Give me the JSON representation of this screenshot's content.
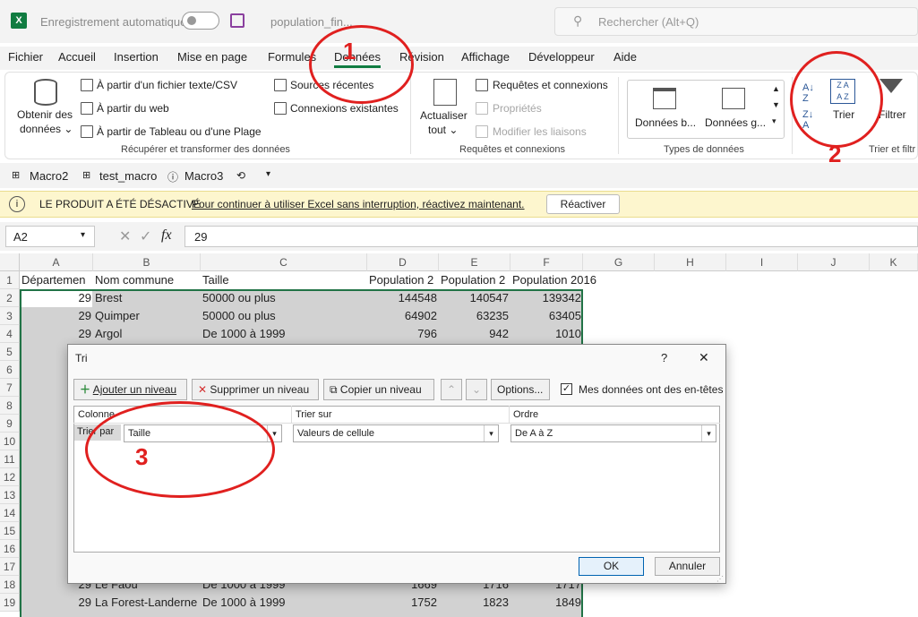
{
  "title": {
    "app_icon": "X",
    "autosave": "Enregistrement automatique",
    "filename": "population_fin...",
    "search": "Rechercher (Alt+Q)"
  },
  "menu": [
    "Fichier",
    "Accueil",
    "Insertion",
    "Mise en page",
    "Formules",
    "Données",
    "Révision",
    "Affichage",
    "Développeur",
    "Aide"
  ],
  "ribbon": {
    "get_data": [
      "Obtenir des",
      "données ⌄"
    ],
    "from_csv": "À partir d'un fichier texte/CSV",
    "from_web": "À partir du web",
    "from_table": "À partir de Tableau ou d'une Plage",
    "recent": "Sources récentes",
    "existing": "Connexions existantes",
    "grp1": "Récupérer et transformer des données",
    "refresh": [
      "Actualiser",
      "tout ⌄"
    ],
    "queries": "Requêtes et connexions",
    "props": "Propriétés",
    "links": "Modifier les liaisons",
    "grp2": "Requêtes et connexions",
    "dt1": "Données b...",
    "dt2": "Données g...",
    "grp3": "Types de données",
    "sort": "Trier",
    "filter": "Filtrer",
    "grp4": "Trier et filtr"
  },
  "quickaccess": [
    "Macro2",
    "test_macro",
    "Macro3"
  ],
  "banner": {
    "title": "LE PRODUIT A ÉTÉ DÉSACTIVÉ",
    "msg": "Pour continuer à utiliser Excel sans interruption, réactivez maintenant.",
    "btn": "Réactiver"
  },
  "formula": {
    "cell": "A2",
    "value": "29",
    "fx": "fx"
  },
  "columns": [
    "A",
    "B",
    "C",
    "D",
    "E",
    "F",
    "G",
    "H",
    "I",
    "J",
    "K"
  ],
  "header_row": [
    "Départemen",
    "Nom commune",
    "Taille",
    "Population 2",
    "Population 2",
    "Population 2016"
  ],
  "rows": [
    [
      "29",
      "Brest",
      "50000 ou plus",
      "144548",
      "140547",
      "139342"
    ],
    [
      "29",
      "Quimper",
      "50000 ou plus",
      "64902",
      "63235",
      "63405"
    ],
    [
      "29",
      "Argol",
      "De 1000 à 1999",
      "796",
      "942",
      "1010"
    ]
  ],
  "bottom_rows": [
    [
      "29",
      "Le Faou",
      "De 1000 à 1999",
      "1669",
      "1716",
      "1717"
    ],
    [
      "29",
      "La Forest-Landerne",
      "De 1000 à 1999",
      "1752",
      "1823",
      "1849"
    ]
  ],
  "row_numbers": [
    "1",
    "2",
    "3",
    "4",
    "5",
    "6",
    "7",
    "8",
    "9",
    "10",
    "11",
    "12",
    "13",
    "14",
    "15",
    "16",
    "17",
    "18",
    "19"
  ],
  "dialog": {
    "title": "Tri",
    "help": "?",
    "close": "✕",
    "add": "Ajouter un niveau",
    "del": "Supprimer un niveau",
    "copy": "Copier un niveau",
    "options": "Options...",
    "headers_check": "Mes données ont des en-têtes",
    "col_hdr": "Colonne",
    "sort_on_hdr": "Trier sur",
    "order_hdr": "Ordre",
    "sortby": "Trier par",
    "col_val": "Taille",
    "sort_on_val": "Valeurs de cellule",
    "order_val": "De A à Z",
    "ok": "OK",
    "cancel": "Annuler"
  },
  "annotations": {
    "n1": "1",
    "n2": "2",
    "n3": "3",
    "color": "#e0201f"
  }
}
